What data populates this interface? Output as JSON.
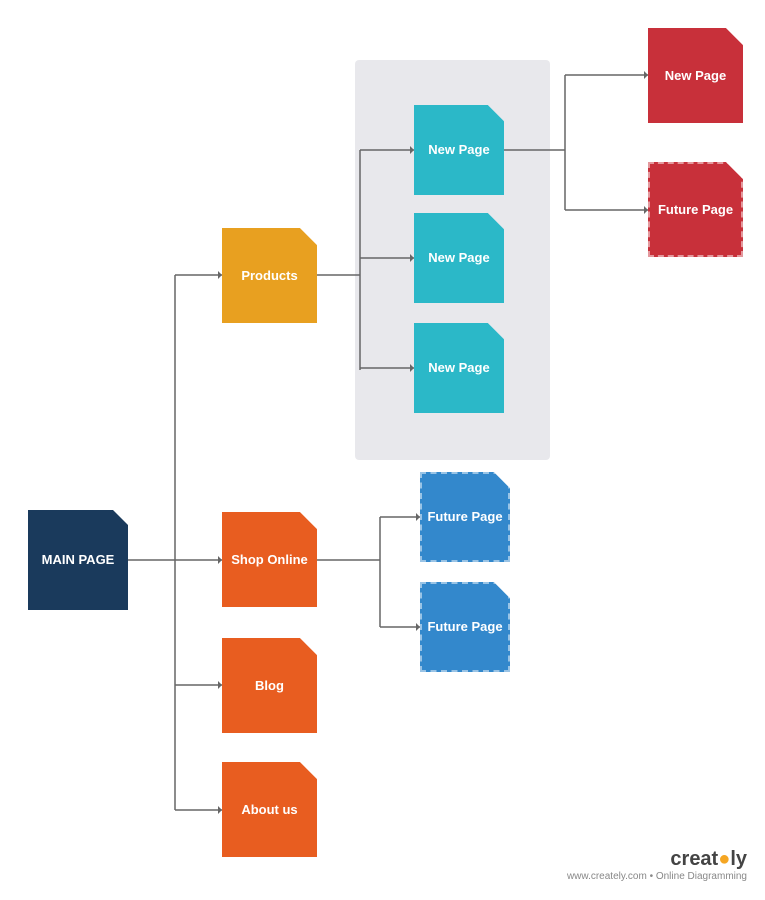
{
  "nodes": {
    "main_page": {
      "label": "MAIN PAGE"
    },
    "products": {
      "label": "Products"
    },
    "shop_online": {
      "label": "Shop Online"
    },
    "blog": {
      "label": "Blog"
    },
    "about_us": {
      "label": "About us"
    },
    "new_page_1": {
      "label": "New Page"
    },
    "new_page_2": {
      "label": "New Page"
    },
    "new_page_3": {
      "label": "New Page"
    },
    "new_page_red_1": {
      "label": "New Page"
    },
    "future_page_red": {
      "label": "Future Page"
    },
    "future_page_blue_1": {
      "label": "Future Page"
    },
    "future_page_blue_2": {
      "label": "Future Page"
    }
  },
  "logo": {
    "name": "creately",
    "tagline": "www.creately.com • Online Diagramming"
  },
  "colors": {
    "main_page": "#1a3a5c",
    "products": "#e8a020",
    "shop_online": "#e85d20",
    "blog": "#e85d20",
    "about_us": "#e85d20",
    "new_page_teal": "#2bb8c8",
    "new_page_red": "#c8303a",
    "future_page_blue": "#3388cc",
    "gray_box": "#e8e8ec",
    "line": "#666666"
  }
}
